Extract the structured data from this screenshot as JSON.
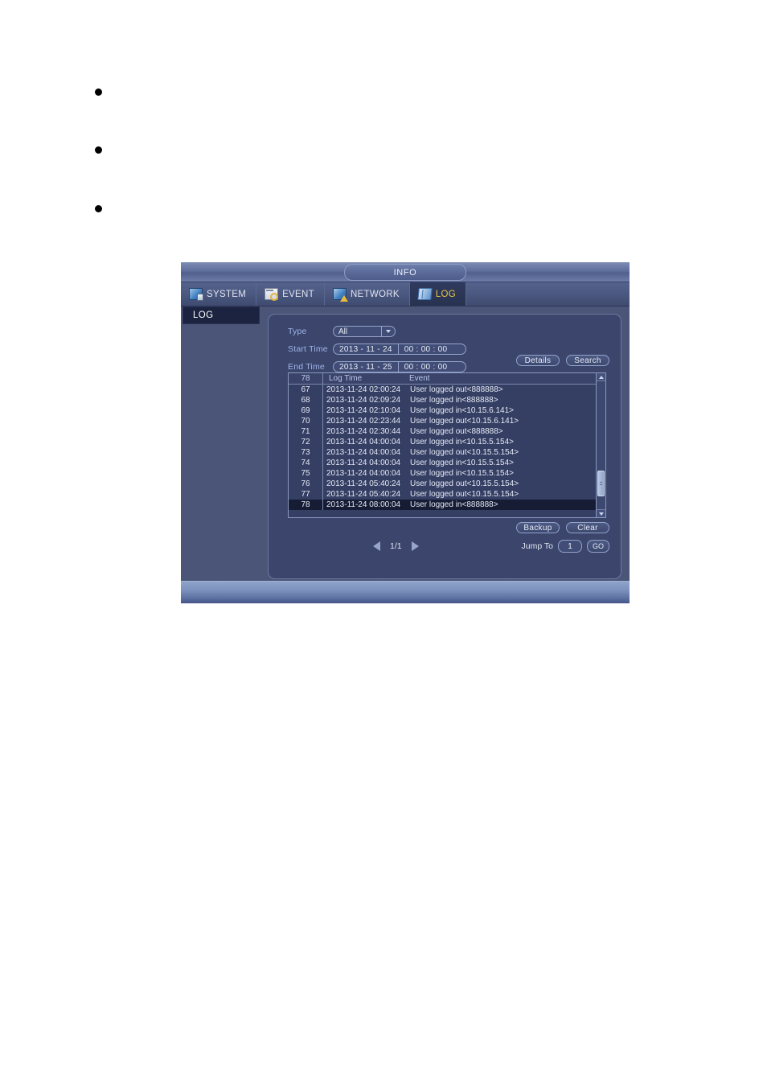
{
  "page": {
    "bullets": [
      "",
      "",
      ""
    ]
  },
  "window": {
    "title": "INFO",
    "tabs": [
      {
        "label": "SYSTEM",
        "icon": "monitor-icon",
        "active": false
      },
      {
        "label": "EVENT",
        "icon": "event-search-icon",
        "active": false
      },
      {
        "label": "NETWORK",
        "icon": "network-warning-icon",
        "active": false
      },
      {
        "label": "LOG",
        "icon": "log-book-icon",
        "active": true
      }
    ],
    "sidebar": {
      "items": [
        {
          "label": "LOG",
          "active": true
        }
      ]
    },
    "form": {
      "type_label": "Type",
      "type_value": "All",
      "type_options": [
        "All"
      ],
      "start_label": "Start Time",
      "start_date": "2013 - 11 - 24",
      "start_time": "00 : 00 : 00",
      "end_label": "End Time",
      "end_date": "2013 - 11 - 25",
      "end_time": "00 : 00 : 00",
      "details_label": "Details",
      "search_label": "Search"
    },
    "table": {
      "count_header": "78",
      "col_time": "Log Time",
      "col_event": "Event",
      "rows": [
        {
          "no": "67",
          "time": "2013-11-24 02:00:24",
          "event": "User logged out<888888>",
          "selected": false
        },
        {
          "no": "68",
          "time": "2013-11-24 02:09:24",
          "event": "User logged in<888888>",
          "selected": false
        },
        {
          "no": "69",
          "time": "2013-11-24 02:10:04",
          "event": "User logged in<10.15.6.141>",
          "selected": false
        },
        {
          "no": "70",
          "time": "2013-11-24 02:23:44",
          "event": "User logged out<10.15.6.141>",
          "selected": false
        },
        {
          "no": "71",
          "time": "2013-11-24 02:30:44",
          "event": "User logged out<888888>",
          "selected": false
        },
        {
          "no": "72",
          "time": "2013-11-24 04:00:04",
          "event": "User logged in<10.15.5.154>",
          "selected": false
        },
        {
          "no": "73",
          "time": "2013-11-24 04:00:04",
          "event": "User logged out<10.15.5.154>",
          "selected": false
        },
        {
          "no": "74",
          "time": "2013-11-24 04:00:04",
          "event": "User logged in<10.15.5.154>",
          "selected": false
        },
        {
          "no": "75",
          "time": "2013-11-24 04:00:04",
          "event": "User logged in<10.15.5.154>",
          "selected": false
        },
        {
          "no": "76",
          "time": "2013-11-24 05:40:24",
          "event": "User logged out<10.15.5.154>",
          "selected": false
        },
        {
          "no": "77",
          "time": "2013-11-24 05:40:24",
          "event": "User logged out<10.15.5.154>",
          "selected": false
        },
        {
          "no": "78",
          "time": "2013-11-24 08:00:04",
          "event": "User logged in<888888>",
          "selected": true
        }
      ]
    },
    "actions": {
      "backup_label": "Backup",
      "clear_label": "Clear"
    },
    "pager": {
      "prev_icon": "arrow-left-icon",
      "page_indicator": "1/1",
      "next_icon": "arrow-right-icon",
      "jump_label": "Jump To",
      "jump_value": "1",
      "go_label": "GO"
    }
  },
  "colors": {
    "window_bg": "#4a5578",
    "panel_bg": "#3c466c",
    "accent_active_tab_text": "#e8c547",
    "label_text": "#9db3e8",
    "row_selected_bg": "#151c33"
  }
}
